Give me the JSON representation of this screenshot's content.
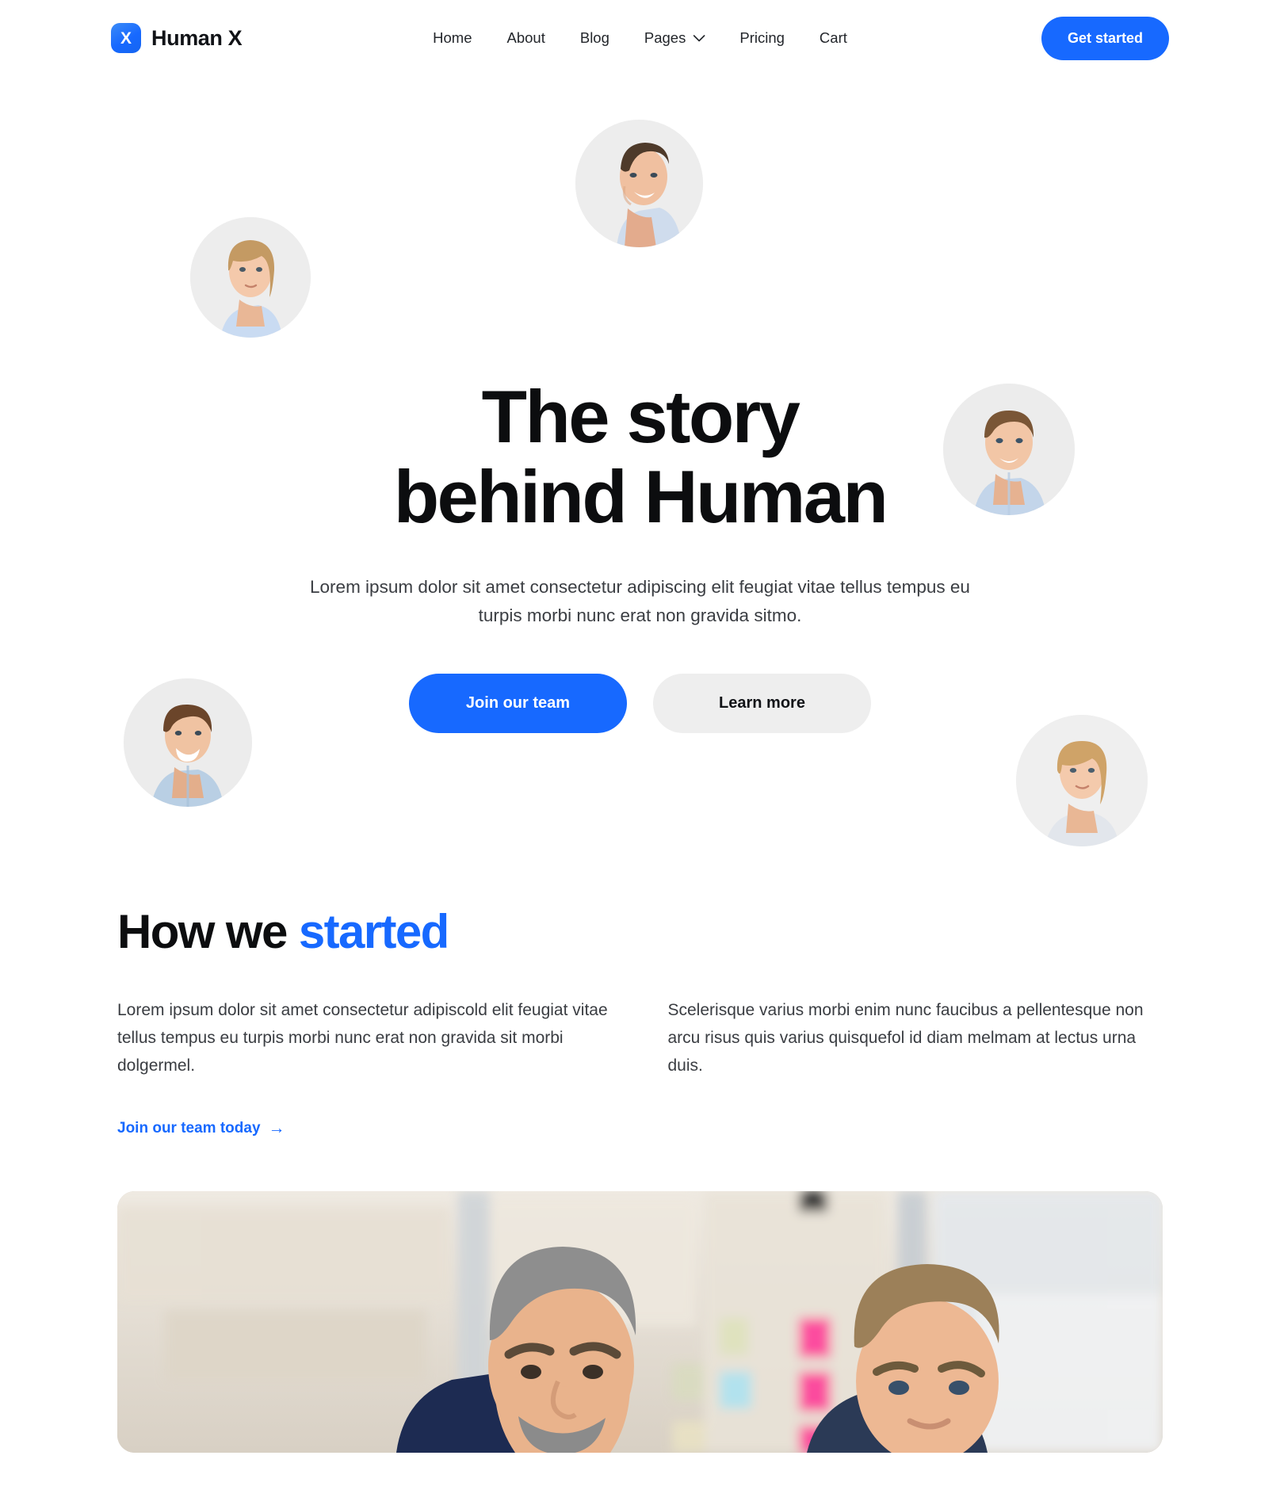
{
  "brand": {
    "logo_glyph": "X",
    "name": "Human X",
    "logo_icon": "logo-x-icon"
  },
  "nav": {
    "items": [
      {
        "label": "Home",
        "has_chevron": false
      },
      {
        "label": "About",
        "has_chevron": false
      },
      {
        "label": "Blog",
        "has_chevron": false
      },
      {
        "label": "Pages",
        "has_chevron": true
      },
      {
        "label": "Pricing",
        "has_chevron": false
      },
      {
        "label": "Cart",
        "has_chevron": false
      }
    ],
    "cta_label": "Get started"
  },
  "hero": {
    "title_line1": "The story",
    "title_line2": "behind Human",
    "subtitle": "Lorem ipsum dolor sit amet consectetur adipiscing elit feugiat vitae tellus tempus eu turpis morbi nunc erat non gravida sitmo.",
    "primary_button": "Join our team",
    "secondary_button": "Learn more",
    "avatars": [
      {
        "name": "avatar-top-center",
        "alt": "smiling man in light blue shirt"
      },
      {
        "name": "avatar-left-upper",
        "alt": "blonde woman in light blue sweater"
      },
      {
        "name": "avatar-right-upper",
        "alt": "young man in blue shirt"
      },
      {
        "name": "avatar-left-lower",
        "alt": "laughing man in denim shirt"
      },
      {
        "name": "avatar-right-lower",
        "alt": "blonde woman in light grey top"
      }
    ]
  },
  "story": {
    "title_plain": "How we ",
    "title_accent": "started",
    "column_left": "Lorem ipsum dolor sit amet consectetur adipiscold elit feugiat vitae tellus tempus eu turpis morbi nunc erat non gravida sit morbi dolgermel.",
    "column_right": "Scelerisque varius morbi enim nunc faucibus a pellentesque non arcu risus quis varius quisquefol id diam melmam at lectus urna duis.",
    "link_label": "Join our team today",
    "link_arrow": "→"
  },
  "photo": {
    "alt": "two colleagues smiling in an office in front of a whiteboard with sticky notes"
  },
  "colors": {
    "accent_blue": "#1769ff",
    "text_dark": "#0c0d0f",
    "text_body": "#3a3d42",
    "avatar_bg": "#ededed",
    "button_secondary_bg": "#eeeeee"
  }
}
